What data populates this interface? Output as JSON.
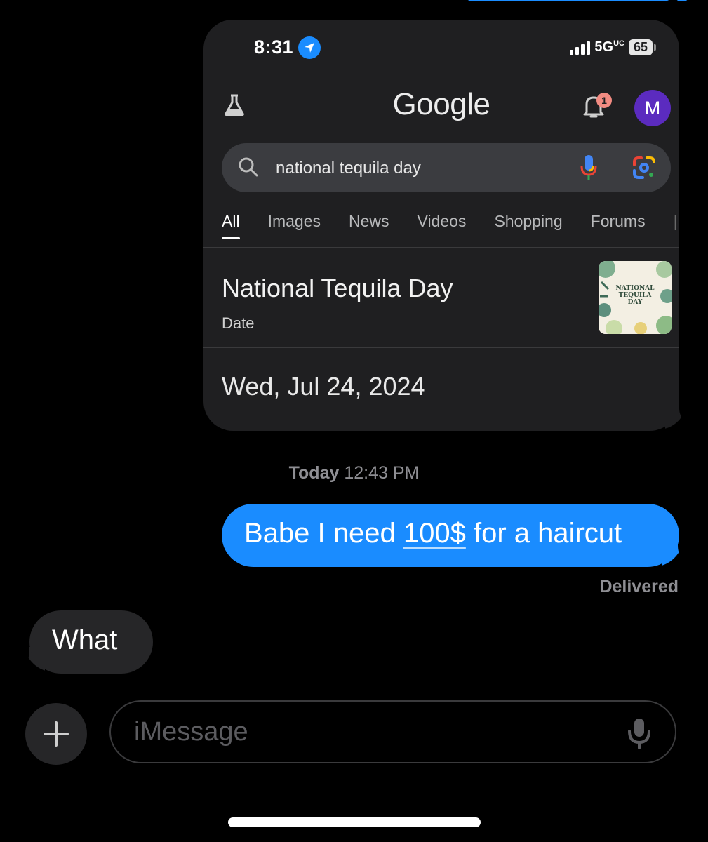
{
  "screenshot": {
    "status_bar": {
      "time": "8:31",
      "network": "5G",
      "network_suffix": "UC",
      "battery": "65"
    },
    "google": {
      "logo": "Google",
      "notification_count": "1",
      "avatar_initial": "M",
      "search_query": "national tequila day",
      "tabs": [
        "All",
        "Images",
        "News",
        "Videos",
        "Shopping",
        "Forums"
      ],
      "active_tab": "All",
      "result_title": "National Tequila Day",
      "result_subtitle": "Date",
      "thumbnail_text": "NATIONAL TEQUILA DAY",
      "result_date": "Wed, Jul 24, 2024"
    }
  },
  "conversation": {
    "timestamp_day": "Today",
    "timestamp_time": "12:43 PM",
    "sent_message_prefix": "Babe I need ",
    "sent_message_link": "100$",
    "sent_message_suffix": " for a haircut",
    "delivery_status": "Delivered",
    "received_message": "What"
  },
  "composer": {
    "placeholder": "iMessage"
  },
  "colors": {
    "sent_bubble": "#1a8cff",
    "received_bubble": "#262628",
    "screenshot_bg": "#1f1f21",
    "avatar": "#5b2bbf"
  }
}
